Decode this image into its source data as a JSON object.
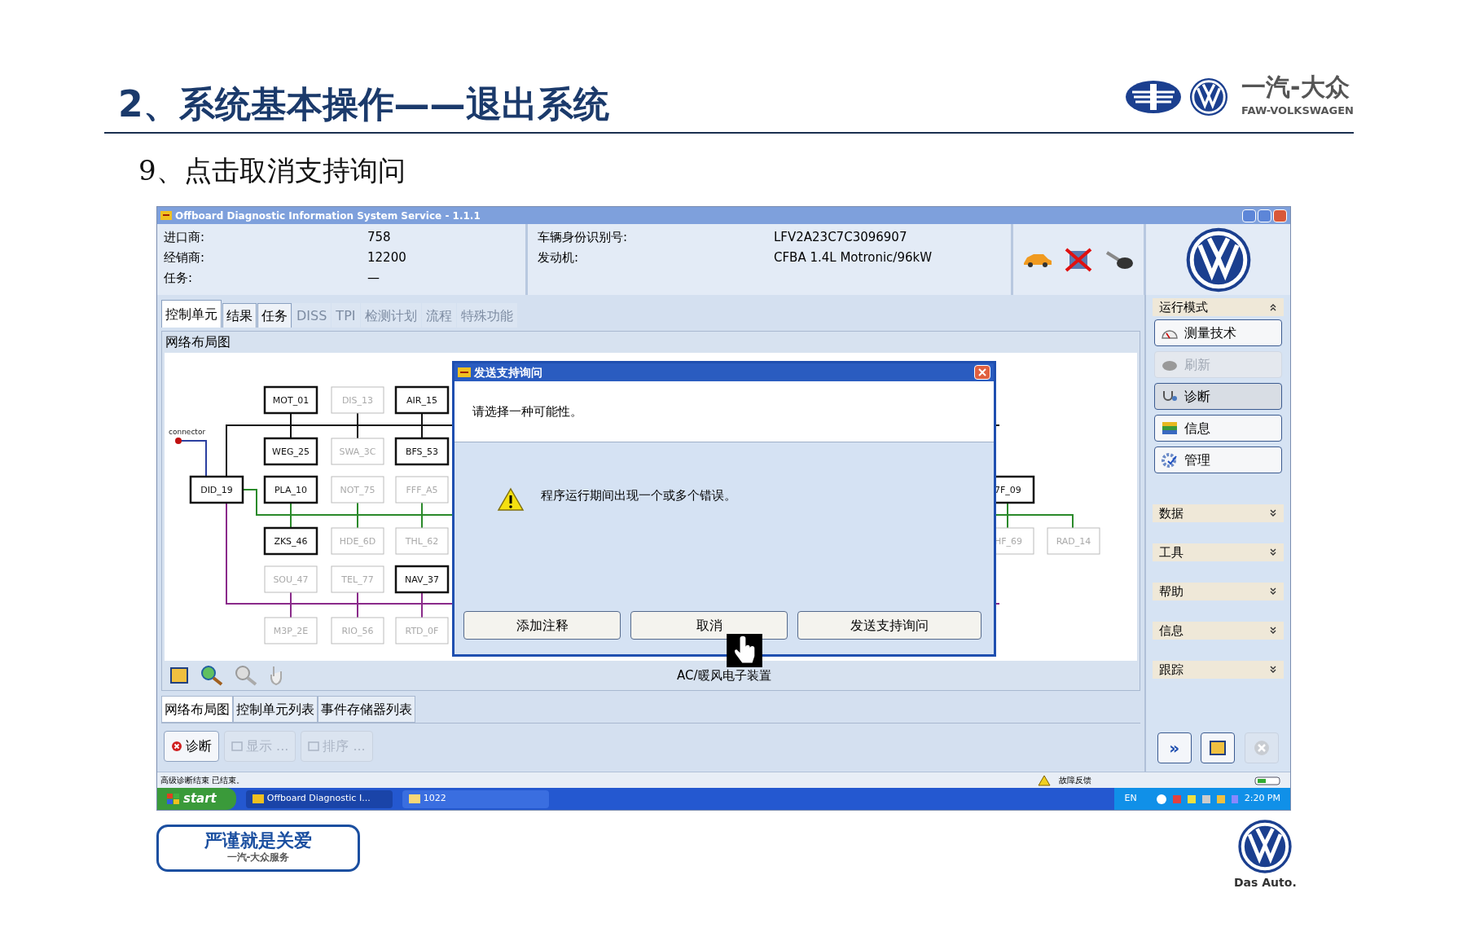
{
  "slide": {
    "title": "2、系统基本操作——退出系统",
    "brand": {
      "name": "一汽-大众",
      "name_latin": "FAW-VOLKSWAGEN"
    },
    "step": "9、点击取消支持询问",
    "footer_left": {
      "slogan": "严谨就是关爱",
      "service": "一汽-大众服务"
    },
    "footer_right": {
      "tagline": "Das Auto."
    }
  },
  "window": {
    "title": "Offboard Diagnostic Information System Service - 1.1.1",
    "info_left": [
      {
        "label": "进口商:",
        "value": "758"
      },
      {
        "label": "经销商:",
        "value": "12200"
      },
      {
        "label": "任务:",
        "value": "—"
      }
    ],
    "info_right": [
      {
        "label": "车辆身份识别号:",
        "value": "LFV2A23C7C3096907"
      },
      {
        "label": "发动机:",
        "value": "CFBA 1.4L Motronic/96kW"
      }
    ],
    "tabs": [
      {
        "label": "控制单元",
        "selected": true,
        "disabled": false
      },
      {
        "label": "结果",
        "selected": false,
        "disabled": false
      },
      {
        "label": "任务",
        "selected": false,
        "disabled": false
      },
      {
        "label": "DISS",
        "selected": false,
        "disabled": true
      },
      {
        "label": "TPI",
        "selected": false,
        "disabled": true
      },
      {
        "label": "检测计划",
        "selected": false,
        "disabled": true
      },
      {
        "label": "流程",
        "selected": false,
        "disabled": true
      },
      {
        "label": "特殊功能",
        "selected": false,
        "disabled": true
      }
    ],
    "network": {
      "title": "网络布局图",
      "connector_label": "connector",
      "nodes": [
        {
          "label": "MOT_01",
          "active": true
        },
        {
          "label": "DIS_13",
          "active": false
        },
        {
          "label": "AIR_15",
          "active": true
        },
        {
          "label": "WEG_25",
          "active": true
        },
        {
          "label": "SWA_3C",
          "active": false
        },
        {
          "label": "BFS_53",
          "active": true
        },
        {
          "label": "DID_19",
          "active": true
        },
        {
          "label": "PLA_10",
          "active": true
        },
        {
          "label": "NOT_75",
          "active": false
        },
        {
          "label": "FFF_A5",
          "active": false
        },
        {
          "label": "7F_09",
          "active": true
        },
        {
          "label": "ZKS_46",
          "active": true
        },
        {
          "label": "HDE_6D",
          "active": false
        },
        {
          "label": "THL_62",
          "active": false
        },
        {
          "label": "HF_69",
          "active": false
        },
        {
          "label": "RAD_14",
          "active": false
        },
        {
          "label": "SOU_47",
          "active": false
        },
        {
          "label": "TEL_77",
          "active": false
        },
        {
          "label": "NAV_37",
          "active": true
        },
        {
          "label": "M3P_2E",
          "active": false
        },
        {
          "label": "RIO_56",
          "active": false
        },
        {
          "label": "RTD_0F",
          "active": false
        }
      ],
      "selected_unit": "AC/暖风电子装置"
    },
    "bottom_tabs": [
      {
        "label": "网络布局图",
        "selected": true
      },
      {
        "label": "控制单元列表",
        "selected": false
      },
      {
        "label": "事件存储器列表",
        "selected": false
      }
    ],
    "actions": [
      {
        "label": "诊断",
        "disabled": false
      },
      {
        "label": "显示 ...",
        "disabled": true
      },
      {
        "label": "排序 ...",
        "disabled": true
      }
    ],
    "sidebar": {
      "mode_title": "运行模式",
      "mode_buttons": [
        {
          "label": "测量技术",
          "selected": false,
          "disabled": false
        },
        {
          "label": "刷新",
          "selected": false,
          "disabled": true
        },
        {
          "label": "诊断",
          "selected": true,
          "disabled": false
        },
        {
          "label": "信息",
          "selected": false,
          "disabled": false
        },
        {
          "label": "管理",
          "selected": false,
          "disabled": false
        }
      ],
      "sections": [
        {
          "label": "数据",
          "expanded": false
        },
        {
          "label": "工具",
          "expanded": false
        },
        {
          "label": "帮助",
          "expanded": false
        },
        {
          "label": "信息",
          "expanded": false
        },
        {
          "label": "跟踪",
          "expanded": false
        }
      ],
      "nav_button": "»"
    },
    "status_bar": {
      "message": "高级诊断结束 已结束。",
      "feedback": "故障反馈"
    },
    "dialog": {
      "title": "发送支持询问",
      "prompt": "请选择一种可能性。",
      "message": "程序运行期间出现一个或多个错误。",
      "buttons": [
        "添加注释",
        "取消",
        "发送支持询问"
      ]
    }
  },
  "taskbar": {
    "start": "start",
    "items": [
      {
        "label": "Offboard Diagnostic I...",
        "selected": true
      },
      {
        "label": "1022",
        "selected": false
      }
    ],
    "language": "EN",
    "time": "2:20 PM"
  }
}
